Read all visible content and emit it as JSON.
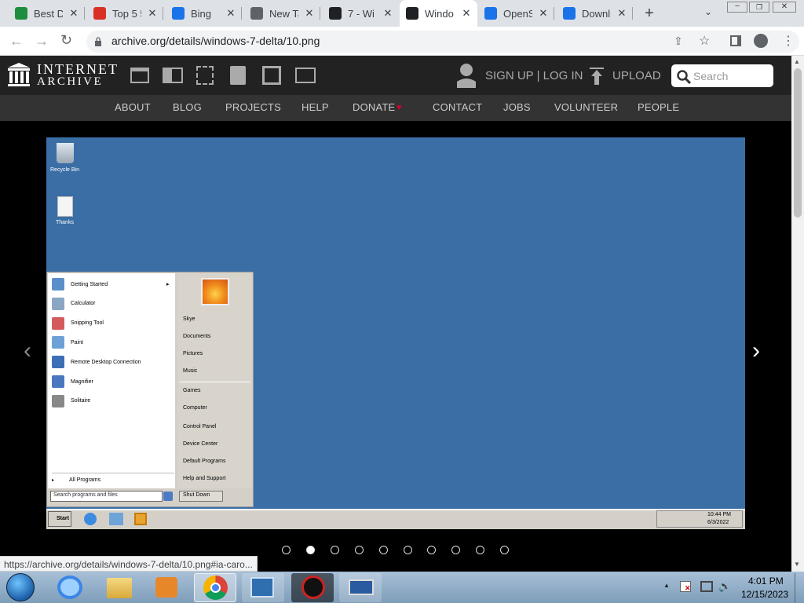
{
  "browser": {
    "tabs": [
      {
        "title": "Best Di",
        "color": "#1e8e3e"
      },
      {
        "title": "Top 5 5",
        "color": "#d93025"
      },
      {
        "title": "Bing",
        "color": "#1a73e8"
      },
      {
        "title": "New Ta",
        "color": "#5f6368"
      },
      {
        "title": "7 - Wi",
        "color": "#202124"
      },
      {
        "title": "Windo",
        "color": "#202124"
      },
      {
        "title": "OpenS",
        "color": "#1a73e8"
      },
      {
        "title": "Downl",
        "color": "#1a73e8"
      }
    ],
    "url": "archive.org/details/windows-7-delta/10.png",
    "status_url": "https://archive.org/details/windows-7-delta/10.png#ia-caro..."
  },
  "ia": {
    "logo_line1": "INTERNET",
    "logo_line2": "ARCHIVE",
    "signin": "SIGN UP | LOG IN",
    "upload": "UPLOAD",
    "search_placeholder": "Search",
    "nav": [
      "ABOUT",
      "BLOG",
      "PROJECTS",
      "HELP",
      "DONATE",
      "CONTACT",
      "JOBS",
      "VOLUNTEER",
      "PEOPLE"
    ],
    "accent": "#d9002c"
  },
  "screenshot": {
    "desktop_icons": [
      "Recycle Bin",
      "Thanks"
    ],
    "start_left": [
      "Getting Started",
      "Calculator",
      "Snipping Tool",
      "Paint",
      "Remote Desktop Connection",
      "Magnifier",
      "Solitaire"
    ],
    "all_programs": "All Programs",
    "search_placeholder": "Search programs and files",
    "start_right": [
      "Skye",
      "Documents",
      "Pictures",
      "Music",
      "Games",
      "Computer",
      "Control Panel",
      "Device Center",
      "Default Programs",
      "Help and Support"
    ],
    "shutdown": "Shut Down",
    "start_button": "Start",
    "clock_time": "10:44 PM",
    "clock_date": "6/3/2022"
  },
  "carousel": {
    "count": 10,
    "active": 1
  },
  "taskbar": {
    "time": "4:01 PM",
    "date": "12/15/2023"
  }
}
